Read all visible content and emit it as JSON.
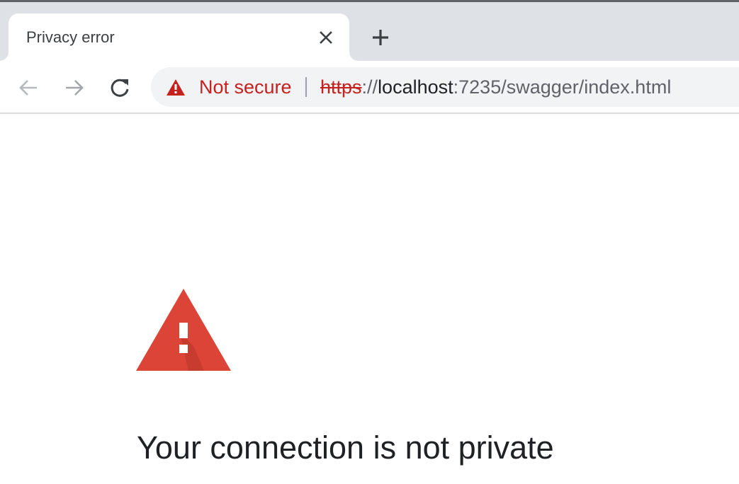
{
  "tab": {
    "title": "Privacy error"
  },
  "icons": {
    "tab_close": "close-icon",
    "new_tab": "plus-icon",
    "back": "arrow-left-icon",
    "forward": "arrow-right-icon",
    "reload": "reload-icon",
    "security": "warning-triangle-icon",
    "page_warning": "large-warning-triangle-icon"
  },
  "omnibox": {
    "security_label": "Not secure",
    "url_scheme": "https",
    "url_separator": "://",
    "url_host": "localhost",
    "url_rest": ":7235/swagger/index.html"
  },
  "page": {
    "heading": "Your connection is not private"
  },
  "colors": {
    "danger": "#c5221f",
    "warning_icon": "#db4437",
    "tab_strip": "#dee1e6",
    "omnibox_bg": "#f1f3f4",
    "text_primary": "#202124"
  }
}
